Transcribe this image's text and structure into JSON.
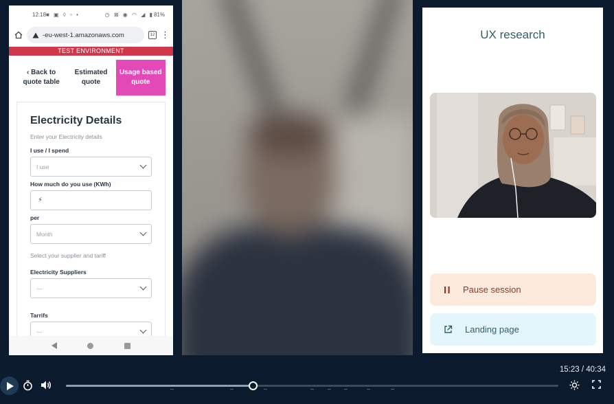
{
  "phone": {
    "status_time": "12:18",
    "status_battery": "81%",
    "url": "-eu-west-1.amazonaws.com",
    "tab_count": "12",
    "banner": "TEST ENVIRONMENT",
    "tabs": [
      {
        "label": "‹ Back to quote table"
      },
      {
        "label": "Estimated quote"
      },
      {
        "label": "Usage based quote"
      }
    ],
    "form": {
      "title": "Electricity Details",
      "subtitle": "Enter your Electricity details",
      "spend_label": "I use / I spend",
      "spend_value": "I use",
      "usage_label": "How much do you use (KWh)",
      "usage_icon": "⚡",
      "per_label": "per",
      "per_value": "Month",
      "supplier_helper": "Select your supplier and tariff",
      "supplier_label": "Electricity Suppliers",
      "supplier_value": "---",
      "tariff_label": "Tarrifs",
      "tariff_value": "---"
    }
  },
  "research": {
    "title": "UX research",
    "pause_label": "Pause session",
    "landing_label": "Landing page"
  },
  "player": {
    "current_time": "15:23",
    "total_time": "40:34",
    "timecode": "15:23 / 40:34",
    "progress": 0.379
  }
}
